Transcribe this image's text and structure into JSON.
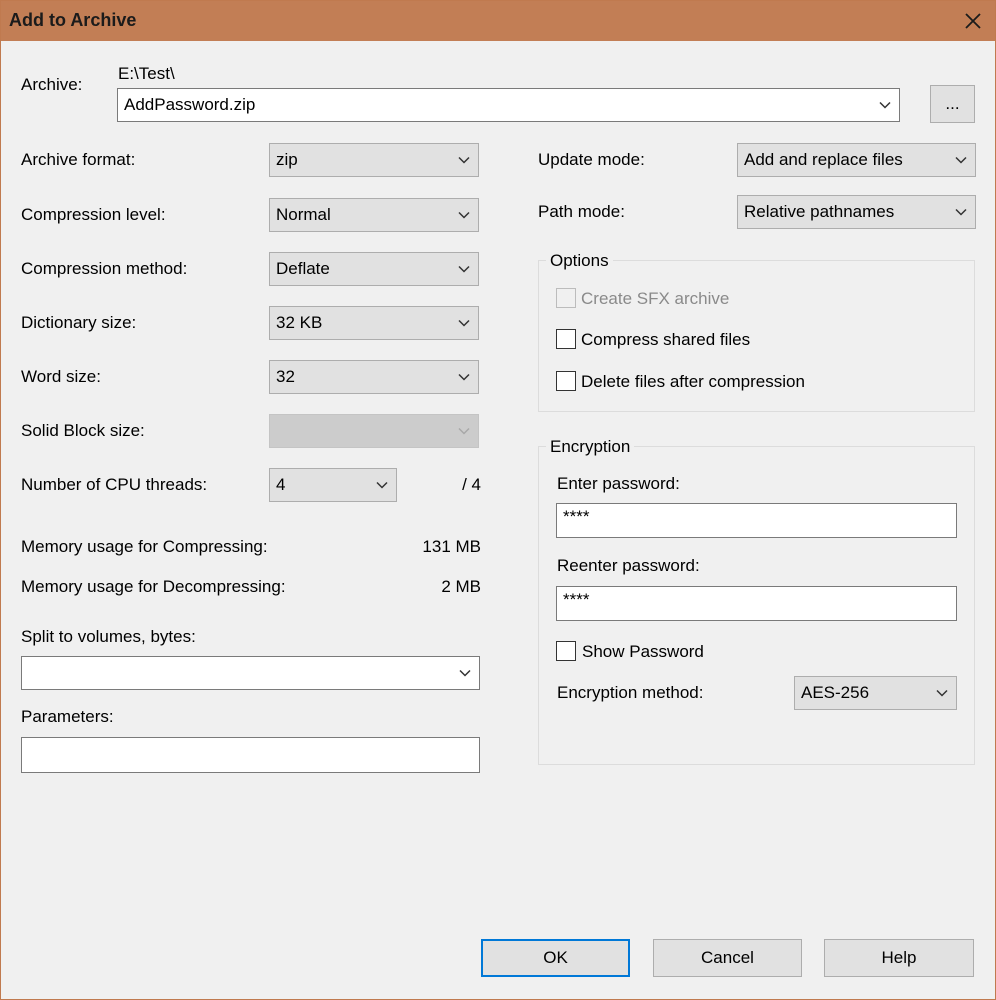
{
  "window": {
    "title": "Add to Archive",
    "close_icon": "close-icon"
  },
  "archive": {
    "label": "Archive:",
    "path": "E:\\Test\\",
    "value": "AddPassword.zip",
    "browse_label": "..."
  },
  "left": {
    "archive_format": {
      "label": "Archive format:",
      "value": "zip"
    },
    "compression_level": {
      "label": "Compression level:",
      "value": "Normal"
    },
    "compression_method": {
      "label": "Compression method:",
      "value": "Deflate"
    },
    "dictionary_size": {
      "label": "Dictionary size:",
      "value": "32 KB"
    },
    "word_size": {
      "label": "Word size:",
      "value": "32"
    },
    "solid_block_size": {
      "label": "Solid Block size:",
      "value": ""
    },
    "cpu_threads": {
      "label": "Number of CPU threads:",
      "value": "4",
      "max": "/ 4"
    },
    "memory_compress": {
      "label": "Memory usage for Compressing:",
      "value": "131 MB"
    },
    "memory_decompress": {
      "label": "Memory usage for Decompressing:",
      "value": "2 MB"
    },
    "split_volumes": {
      "label": "Split to volumes, bytes:",
      "value": ""
    },
    "parameters": {
      "label": "Parameters:",
      "value": ""
    }
  },
  "right": {
    "update_mode": {
      "label": "Update mode:",
      "value": "Add and replace files"
    },
    "path_mode": {
      "label": "Path mode:",
      "value": "Relative pathnames"
    },
    "options": {
      "title": "Options",
      "create_sfx": {
        "label": "Create SFX archive",
        "checked": false,
        "enabled": false
      },
      "compress_shared": {
        "label": "Compress shared files",
        "checked": false
      },
      "delete_after": {
        "label": "Delete files after compression",
        "checked": false
      }
    },
    "encryption": {
      "title": "Encryption",
      "enter_password_label": "Enter password:",
      "enter_password_value": "****",
      "reenter_password_label": "Reenter password:",
      "reenter_password_value": "****",
      "show_password_label": "Show Password",
      "method_label": "Encryption method:",
      "method_value": "AES-256"
    }
  },
  "buttons": {
    "ok": "OK",
    "cancel": "Cancel",
    "help": "Help"
  }
}
